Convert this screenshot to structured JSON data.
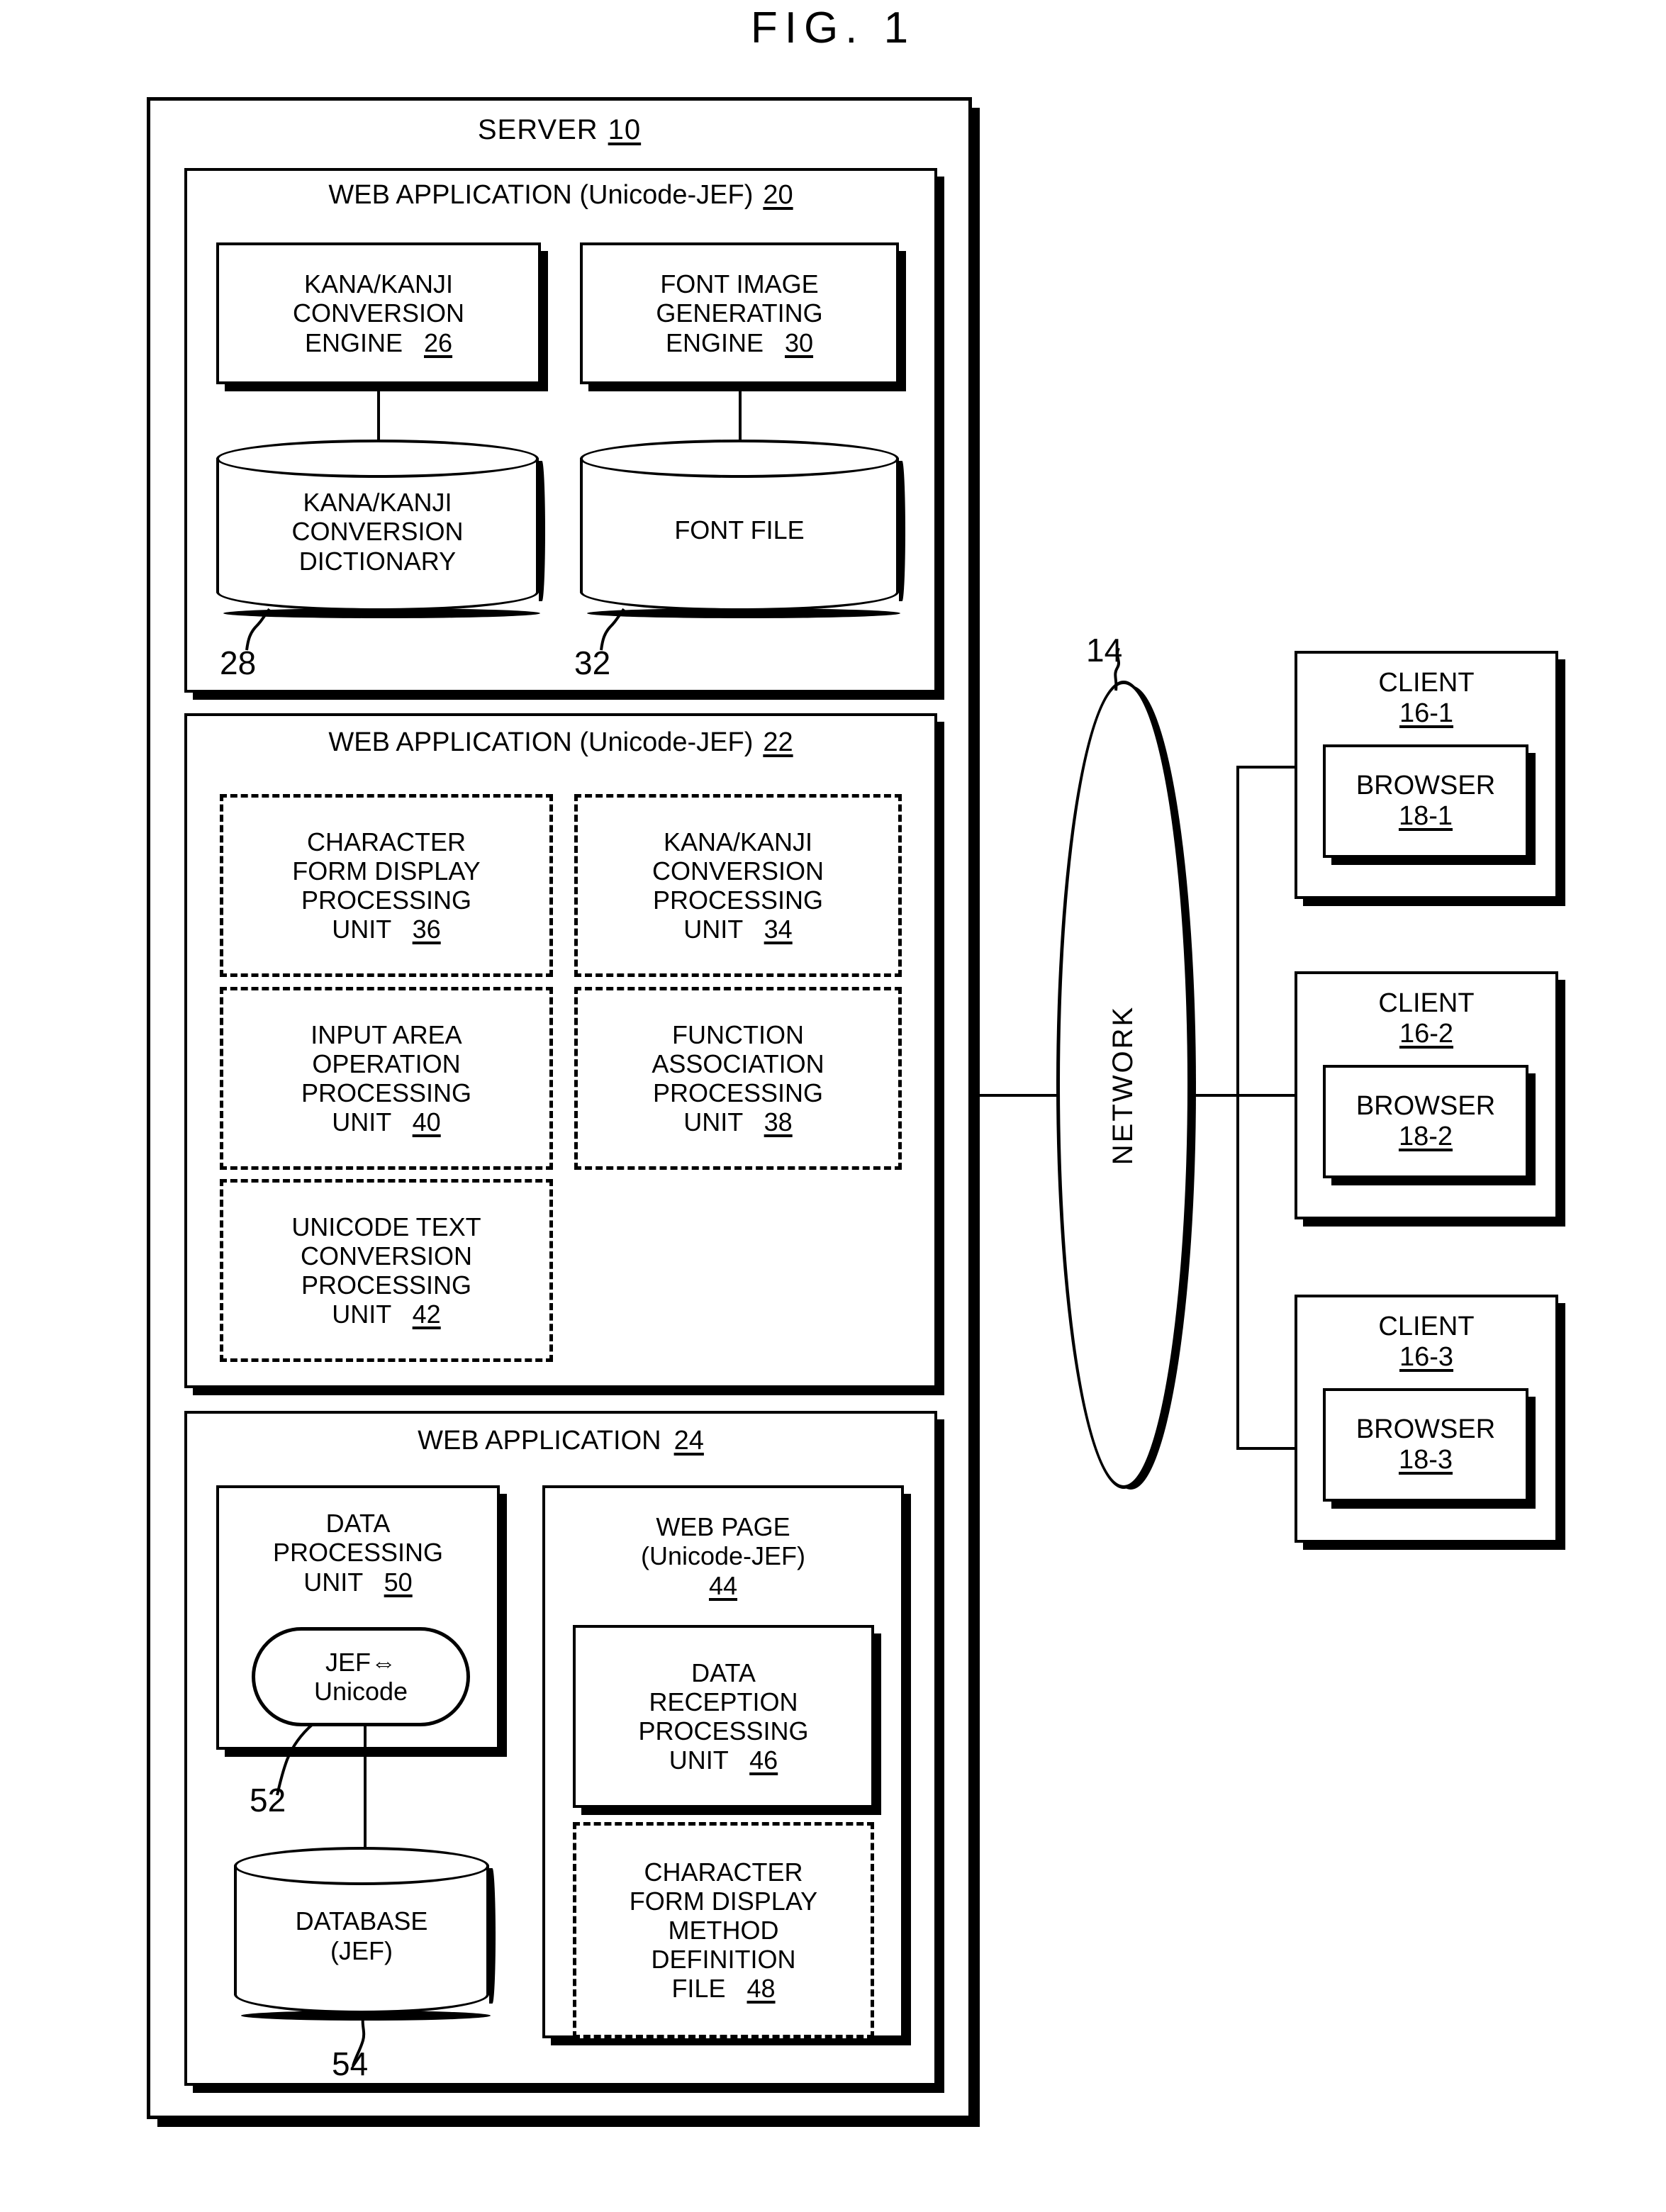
{
  "figure": {
    "title": "FIG. 1"
  },
  "server": {
    "label": "SERVER",
    "ref": "10",
    "apps": [
      {
        "label": "WEB APPLICATION (Unicode-JEF)",
        "ref": "20",
        "engines": [
          {
            "lines": [
              "KANA/KANJI",
              "CONVERSION",
              "ENGINE"
            ],
            "ref": "26"
          },
          {
            "lines": [
              "FONT IMAGE",
              "GENERATING",
              "ENGINE"
            ],
            "ref": "30"
          }
        ],
        "stores": [
          {
            "lines": [
              "KANA/KANJI",
              "CONVERSION",
              "DICTIONARY"
            ],
            "ref": "28"
          },
          {
            "lines": [
              "FONT FILE"
            ],
            "ref": "32"
          }
        ]
      },
      {
        "label": "WEB APPLICATION (Unicode-JEF)",
        "ref": "22",
        "units": [
          {
            "lines": [
              "CHARACTER",
              "FORM DISPLAY",
              "PROCESSING",
              "UNIT"
            ],
            "ref": "36"
          },
          {
            "lines": [
              "KANA/KANJI",
              "CONVERSION",
              "PROCESSING",
              "UNIT"
            ],
            "ref": "34"
          },
          {
            "lines": [
              "INPUT AREA",
              "OPERATION",
              "PROCESSING",
              "UNIT"
            ],
            "ref": "40"
          },
          {
            "lines": [
              "FUNCTION",
              "ASSOCIATION",
              "PROCESSING",
              "UNIT"
            ],
            "ref": "38"
          },
          {
            "lines": [
              "UNICODE TEXT",
              "CONVERSION",
              "PROCESSING",
              "UNIT"
            ],
            "ref": "42"
          }
        ]
      },
      {
        "label": "WEB APPLICATION",
        "ref": "24",
        "data_processing": {
          "lines": [
            "DATA",
            "PROCESSING",
            "UNIT"
          ],
          "ref": "50"
        },
        "converter": {
          "line1": "JEF⇔",
          "line2": "Unicode",
          "ref": "52"
        },
        "database": {
          "lines": [
            "DATABASE",
            "(JEF)"
          ],
          "ref": "54"
        },
        "web_page": {
          "lines": [
            "WEB PAGE",
            "(Unicode-JEF)"
          ],
          "ref": "44"
        },
        "reception_unit": {
          "lines": [
            "DATA",
            "RECEPTION",
            "PROCESSING",
            "UNIT"
          ],
          "ref": "46"
        },
        "definition_file": {
          "lines": [
            "CHARACTER",
            "FORM DISPLAY",
            "METHOD",
            "DEFINITION",
            "FILE"
          ],
          "ref": "48"
        }
      }
    ]
  },
  "network": {
    "label": "NETWORK",
    "ref": "14"
  },
  "clients": [
    {
      "label": "CLIENT",
      "ref": "16-1",
      "browser_label": "BROWSER",
      "browser_ref": "18-1"
    },
    {
      "label": "CLIENT",
      "ref": "16-2",
      "browser_label": "BROWSER",
      "browser_ref": "18-2"
    },
    {
      "label": "CLIENT",
      "ref": "16-3",
      "browser_label": "BROWSER",
      "browser_ref": "18-3"
    }
  ]
}
